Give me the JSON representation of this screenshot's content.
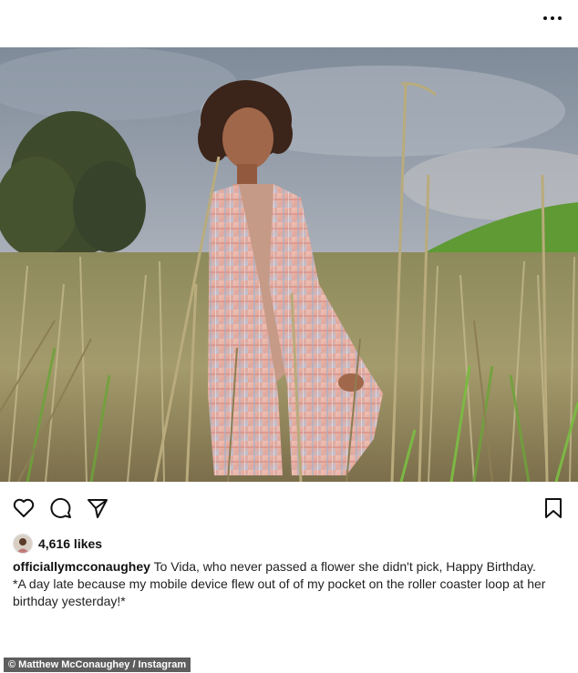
{
  "post": {
    "menu_icon": "more-horizontal-icon",
    "image_alt": "Girl with curly hair wearing a plaid shirt standing in tall grass",
    "actions": {
      "like_icon": "heart-icon",
      "comment_icon": "comment-icon",
      "share_icon": "send-icon",
      "save_icon": "bookmark-icon"
    },
    "likes": "4,616 likes",
    "caption": {
      "username": "officiallymcconaughey",
      "text": " To Vida, who never passed a flower she didn't pick, Happy Birthday.",
      "line2": "*A day late because my mobile device flew out of of my pocket on the roller coaster loop at her",
      "line3": "birthday yesterday!*"
    }
  },
  "credit": "© Matthew McConaughey / Instagram",
  "colors": {
    "sky": "#8f9ba8",
    "grass": "#a79f72",
    "green_grass": "#6ea33a",
    "shirt": "#e7b3a4",
    "credit_bg": "#5e5e5e"
  }
}
